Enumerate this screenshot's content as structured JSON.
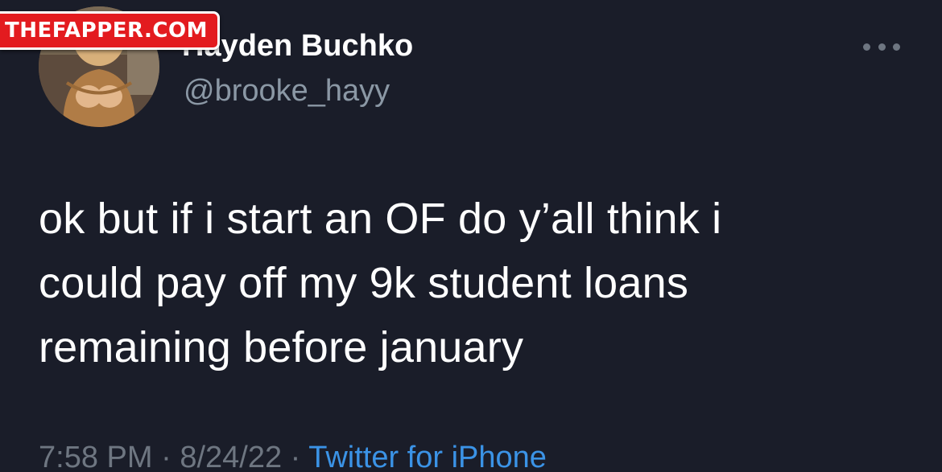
{
  "watermark": {
    "text": "THEFAPPER.COM"
  },
  "tweet": {
    "display_name": "Hayden Buchko",
    "handle": "@brooke_hayy",
    "text": "ok but if i start an OF do y’all think i\ncould pay off my 9k student loans\nremaining before january",
    "time": "7:58 PM",
    "separator": "·",
    "date": "8/24/22",
    "source": "Twitter for iPhone"
  },
  "icons": {
    "more": "more-horizontal-icon",
    "avatar": "profile-avatar"
  },
  "colors": {
    "background": "#1a1d29",
    "text": "#ffffff",
    "secondary": "#8b98a5",
    "link": "#3b93e6",
    "watermark": "#e31b1f"
  }
}
